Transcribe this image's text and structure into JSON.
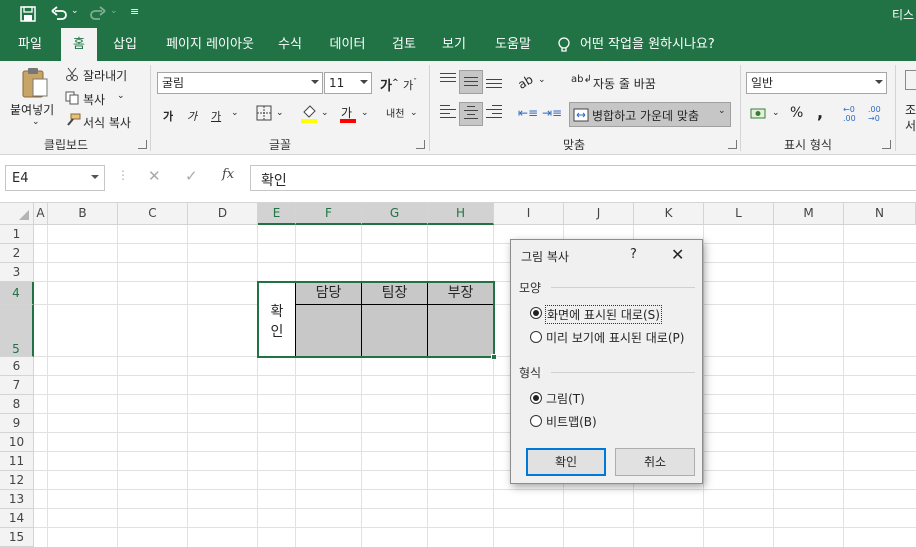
{
  "titlebar": {
    "app_suffix": "티스"
  },
  "tabs": [
    "파일",
    "홈",
    "삽입",
    "페이지 레이아웃",
    "수식",
    "데이터",
    "검토",
    "보기",
    "도움말"
  ],
  "tell_me": "어떤 작업을 원하시나요?",
  "ribbon": {
    "clipboard": {
      "paste": "붙여넣기",
      "cut": "잘라내기",
      "copy": "복사",
      "format_painter": "서식 복사",
      "group": "클립보드"
    },
    "font": {
      "name": "굴림",
      "size": "11",
      "group": "글꼴",
      "bold": "가",
      "italic": "가",
      "underline": "가",
      "font_color_glyph": "가",
      "phonetic": "내천"
    },
    "alignment": {
      "wrap_text": "자동 줄 바꿈",
      "merge_center": "병합하고 가운데 맞춤",
      "group": "맞춤"
    },
    "number": {
      "format": "일반",
      "percent": "%",
      "comma": ",",
      "group": "표시 형식"
    },
    "styles": {
      "partial_1": "조",
      "partial_2": "서"
    }
  },
  "formula_bar": {
    "name_box": "E4",
    "content": "확인",
    "fx": "fx"
  },
  "grid": {
    "columns": [
      "A",
      "B",
      "C",
      "D",
      "E",
      "F",
      "G",
      "H",
      "I",
      "J",
      "K",
      "L",
      "M",
      "N"
    ],
    "rows": [
      "1",
      "2",
      "3",
      "4",
      "5",
      "6",
      "7",
      "8",
      "9",
      "10",
      "11",
      "12",
      "13",
      "14",
      "15"
    ],
    "approval": {
      "label_1": "확",
      "label_2": "인",
      "headers": [
        "담당",
        "팀장",
        "부장"
      ]
    }
  },
  "dialog": {
    "title": "그림 복사",
    "help": "?",
    "appearance_label": "모양",
    "appearance_options": [
      "화면에 표시된 대로(S)",
      "미리 보기에 표시된 대로(P)"
    ],
    "format_label": "형식",
    "format_options": [
      "그림(T)",
      "비트맵(B)"
    ],
    "ok": "확인",
    "cancel": "취소"
  },
  "colors": {
    "excel_green": "#217346",
    "merged_fill": "#c8c8c8",
    "dialog_default_border": "#0078d7"
  }
}
